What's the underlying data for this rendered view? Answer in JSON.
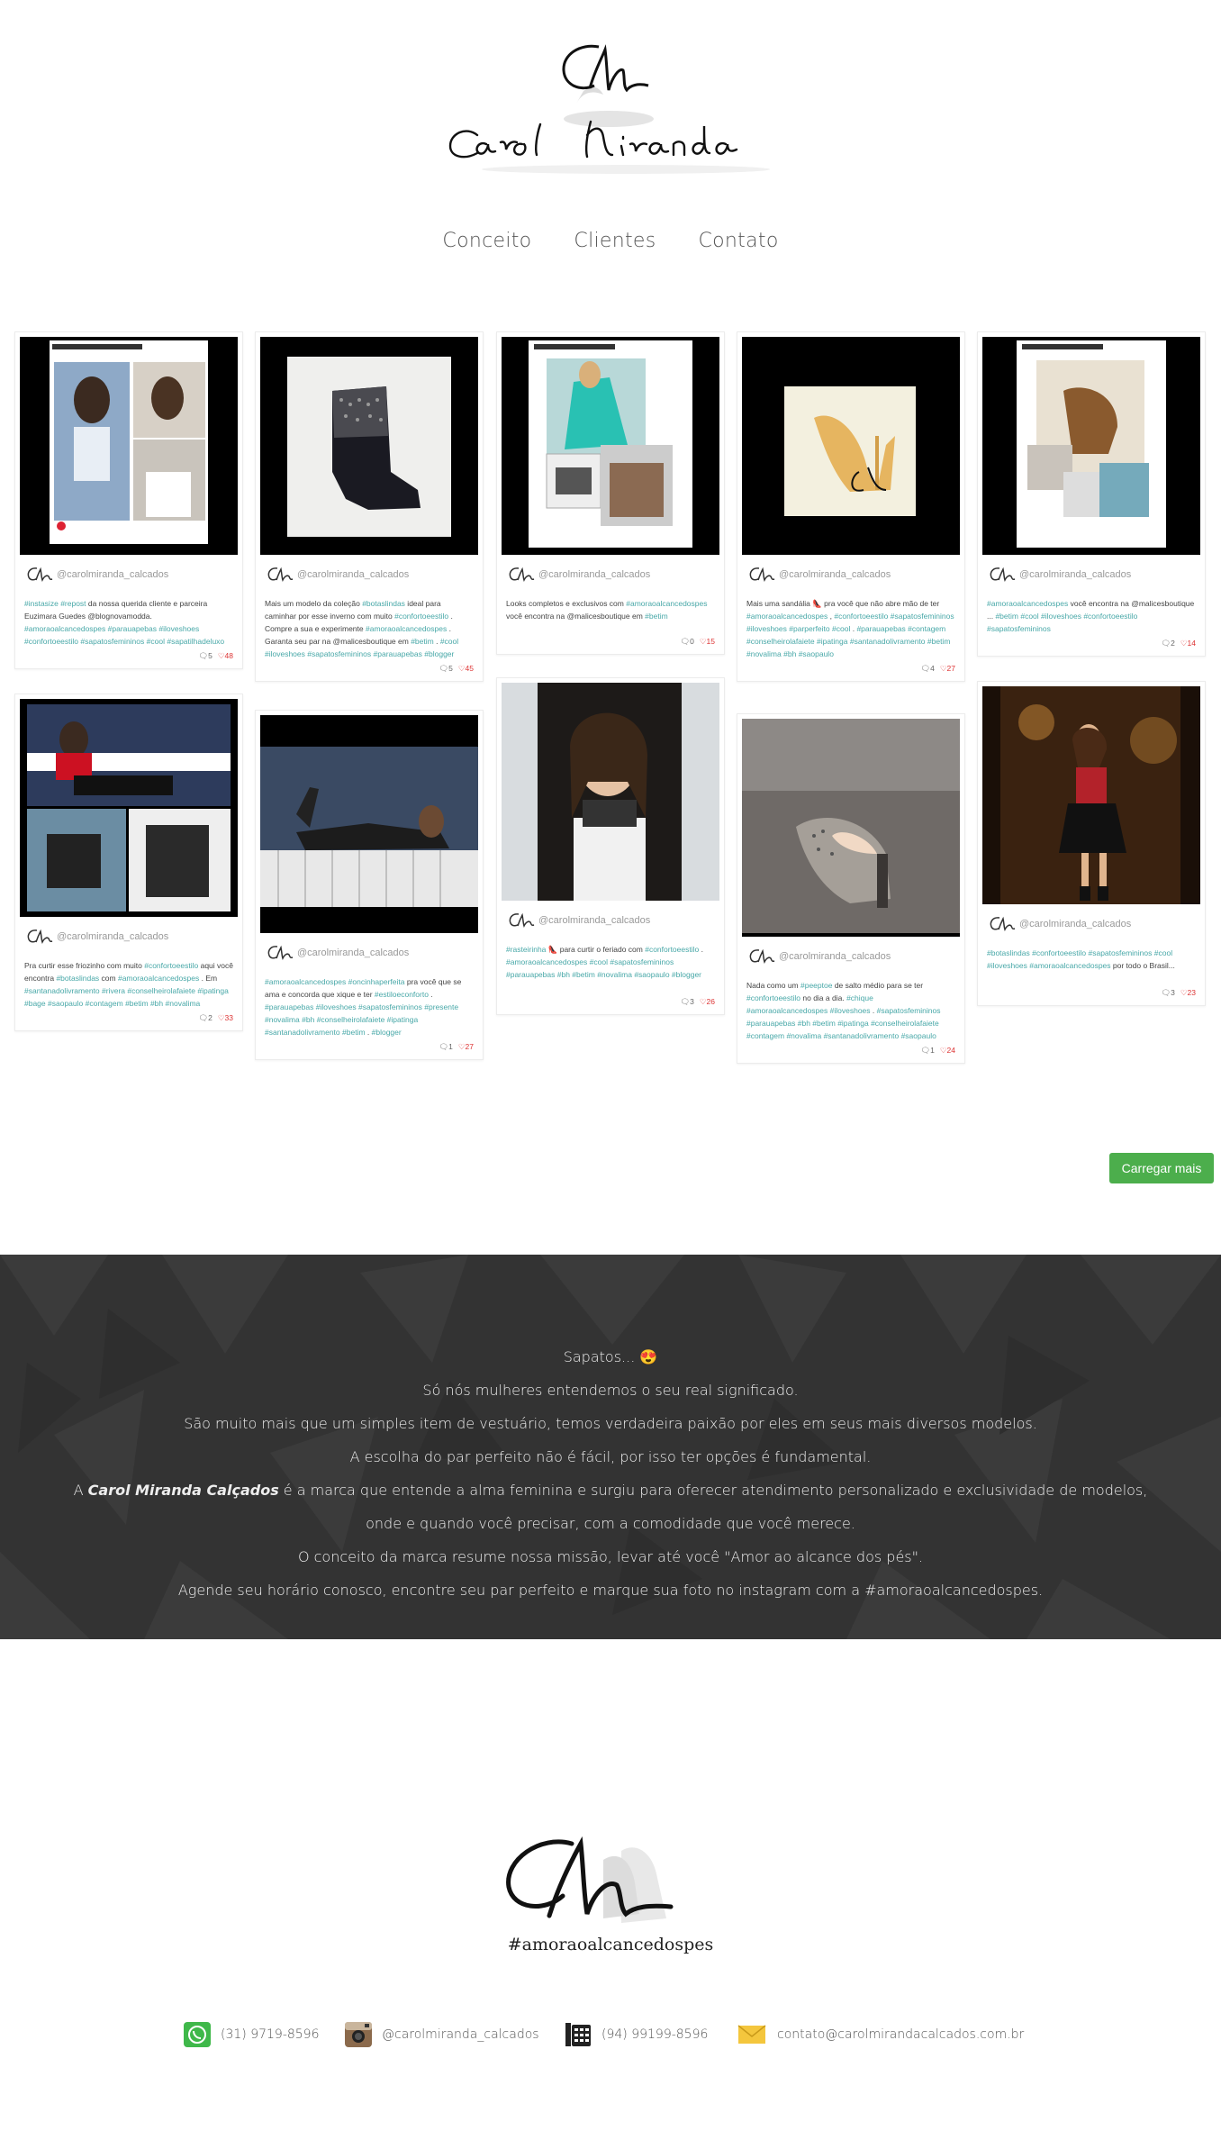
{
  "brand": {
    "name": "Carol Miranda",
    "monogram": "CM"
  },
  "nav": [
    {
      "label": "Conceito"
    },
    {
      "label": "Clientes"
    },
    {
      "label": "Contato"
    }
  ],
  "feed": {
    "username": "@carolmiranda_calcados",
    "load_more": "Carregar mais",
    "posts": [
      {
        "id": "p1",
        "caption": [
          [
            "#instasize",
            "ht"
          ],
          [
            " #repost",
            "ht"
          ],
          [
            "  da nossa querida cliente e parceira Euzimara Guedes @blognovamodda.\n",
            ""
          ],
          [
            "#amoraoalcancedospes #parauapebas #iloveshoes #confortoeestilo #sapatosfemininos #cool #sapatilhadeluxo",
            "ht"
          ]
        ],
        "comments": "5",
        "likes": "48"
      },
      {
        "id": "p2",
        "caption": [
          [
            "Mais um modelo da coleção ",
            ""
          ],
          [
            "#botaslindas",
            ""
          ],
          [
            "  ideal para caminhar por esse inverno com muito ",
            ""
          ],
          [
            "#confortoeestilo",
            ""
          ],
          [
            " . Compre a sua e experimente ",
            ""
          ],
          [
            "#amoraoalcancedospes",
            ""
          ],
          [
            " . Garanta seu par na @malicesboutique em ",
            ""
          ],
          [
            "#betim",
            ""
          ],
          [
            "  . ",
            ""
          ],
          [
            "#cool",
            ""
          ],
          [
            " ",
            ""
          ],
          [
            "#iloveshoes #sapatosfemininos #parauapebas #blogger",
            ""
          ]
        ],
        "comments": "5",
        "likes": "45"
      },
      {
        "id": "p3",
        "caption": [
          [
            "Looks completos e exclusivos com ",
            ""
          ],
          [
            "#amoraoalcancedospes",
            ""
          ],
          [
            "  você encontra na @malicesboutique em ",
            ""
          ],
          [
            "#betim",
            ""
          ]
        ],
        "comments": "0",
        "likes": "15"
      },
      {
        "id": "p4",
        "caption": [
          [
            "Mais uma sandália 👠 pra você que não abre mão de ter ",
            ""
          ],
          [
            "#amoraoalcancedospes",
            ""
          ],
          [
            " , ",
            ""
          ],
          [
            "#confortoeestilo #sapatosfemininos #iloveshoes #parperfeito #cool",
            ""
          ],
          [
            " . ",
            ""
          ],
          [
            "#parauapebas #contagem #conselheirolafaiete #ipatinga #santanadolivramento #betim #novalima #bh #saopaulo",
            ""
          ]
        ],
        "comments": "4",
        "likes": "27"
      },
      {
        "id": "p5",
        "caption": [
          [
            "#amoraoalcancedospes",
            ""
          ],
          [
            "  você encontra na @malicesboutique ... ",
            ""
          ],
          [
            "#betim #cool #iloveshoes #confortoeestilo #sapatosfemininos",
            ""
          ]
        ],
        "comments": "2",
        "likes": "14"
      },
      {
        "id": "p6",
        "caption": [
          [
            "Pra curtir esse friozinho com muito ",
            ""
          ],
          [
            "#confortoeestilo",
            ""
          ],
          [
            "  aqui você encontra ",
            ""
          ],
          [
            "#botaslindas",
            ""
          ],
          [
            "  com ",
            ""
          ],
          [
            "#amoraoalcancedospes",
            ""
          ],
          [
            "  . Em ",
            ""
          ],
          [
            "#santanadolivramento #rivera #conselheirolafaiete #ipatinga #bage #saopaulo #contagem #betim #bh #novalima",
            ""
          ]
        ],
        "comments": "2",
        "likes": "33"
      },
      {
        "id": "p7",
        "caption": [
          [
            "#amoraoalcancedospes #oncinhaperfeita",
            ""
          ],
          [
            "  pra você que se ama e concorda que xique e ter ",
            ""
          ],
          [
            "#estiloeconforto",
            ""
          ],
          [
            " . ",
            ""
          ],
          [
            "#parauapebas #iloveshoes #sapatosfemininos #presente #novalima #bh #conselheirolafaiete #ipatinga #santanadolivramento #betim",
            ""
          ],
          [
            "  . ",
            ""
          ],
          [
            "#blogger",
            ""
          ]
        ],
        "comments": "1",
        "likes": "27"
      },
      {
        "id": "p8",
        "caption": [
          [
            "#rasteirinha",
            ""
          ],
          [
            "  👠  para curtir o feriado com ",
            ""
          ],
          [
            "#confortoeestilo",
            ""
          ],
          [
            "  . ",
            ""
          ],
          [
            "#amoraoalcancedospes #cool #sapatosfemininos #parauapebas #bh #betim #novalima #saopaulo #blogger",
            ""
          ]
        ],
        "comments": "3",
        "likes": "26"
      },
      {
        "id": "p9",
        "caption": [
          [
            "Nada como um ",
            ""
          ],
          [
            "#peeptoe",
            ""
          ],
          [
            "  de salto médio para se ter ",
            ""
          ],
          [
            "#confortoeestilo",
            ""
          ],
          [
            "  no dia a dia. ",
            ""
          ],
          [
            "#chique #amoraoalcancedospes #iloveshoes",
            ""
          ],
          [
            " . ",
            ""
          ],
          [
            "#sapatosfemininos #parauapebas #bh #betim #ipatinga #conselheirolafaiete #contagem #novalima #santanadolivramento #saopaulo",
            ""
          ]
        ],
        "comments": "1",
        "likes": "24"
      },
      {
        "id": "p10",
        "caption": [
          [
            "#botaslindas #confortoeestilo #sapatosfemininos #cool #iloveshoes #amoraoalcancedospes",
            ""
          ],
          [
            "  por todo o Brasil...",
            ""
          ]
        ],
        "comments": "3",
        "likes": "23"
      }
    ]
  },
  "about": {
    "line1": "Sapatos... 😍",
    "line2": "Só nós mulheres entendemos o seu real significado.",
    "line3": "São muito mais que um simples item de vestuário, temos verdadeira paixão por eles em seus mais diversos modelos.",
    "line4": "A escolha do par perfeito não é fácil, por isso ter opções é fundamental.",
    "line5a": "A ",
    "line5b": "Carol Miranda Calçados",
    "line5c": " é a marca que entende a alma feminina e surgiu para oferecer atendimento personalizado e exclusividade de modelos,",
    "line6": "onde e quando você precisar, com a comodidade que você merece.",
    "line7": "O conceito da marca resume nossa missão, levar até você \"Amor ao alcance dos pés\".",
    "line8": "Agende seu horário conosco, encontre seu par perfeito e marque sua foto no instagram com a #amoraoalcancedospes."
  },
  "footer": {
    "tagline": "#amoraoalcancedospes",
    "whatsapp": "(31) 9719-8596",
    "instagram": "@carolmiranda_calcados",
    "phone": "(94) 99199-8596",
    "email": "contato@carolmirandacalcados.com.br"
  },
  "colors": {
    "hashtag": "#48a8a8",
    "likes": "#dd3333",
    "button": "#4cae4c",
    "band": "#333333"
  }
}
